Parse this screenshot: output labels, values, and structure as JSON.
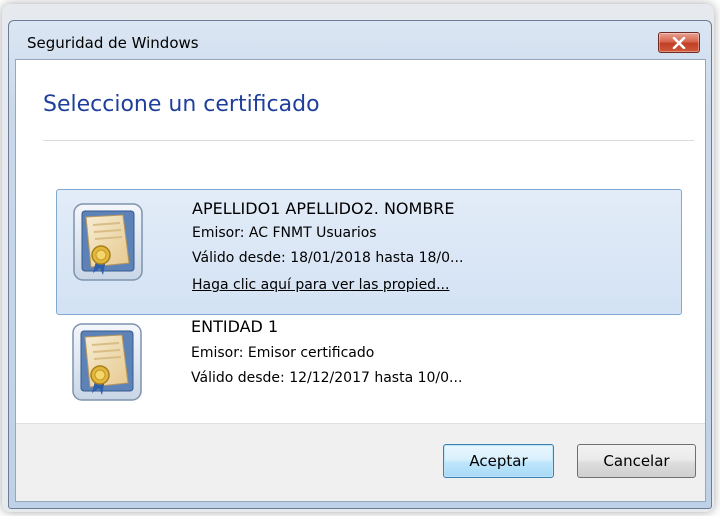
{
  "window": {
    "title": "Seguridad de Windows",
    "close_icon": "close-x-icon"
  },
  "dialog": {
    "heading": "Seleccione un certificado"
  },
  "certificates": [
    {
      "name": "APELLIDO1 APELLIDO2. NOMBRE",
      "issuer": "Emisor: AC FNMT Usuarios",
      "validity": "Válido desde: 18/01/2018 hasta 18/0...",
      "properties_link": "Haga clic aquí para ver las propied...",
      "selected": true,
      "icon": "certificate-icon"
    },
    {
      "name": "ENTIDAD 1",
      "issuer": "Emisor:  Emisor certificado",
      "validity": "Válido desde: 12/12/2017 hasta 10/0...",
      "selected": false,
      "icon": "certificate-icon"
    }
  ],
  "buttons": {
    "accept": "Aceptar",
    "cancel": "Cancelar"
  },
  "colors": {
    "heading": "#1f3f9a",
    "selection": "#d3e2f4",
    "close_button": "#c13f25"
  }
}
